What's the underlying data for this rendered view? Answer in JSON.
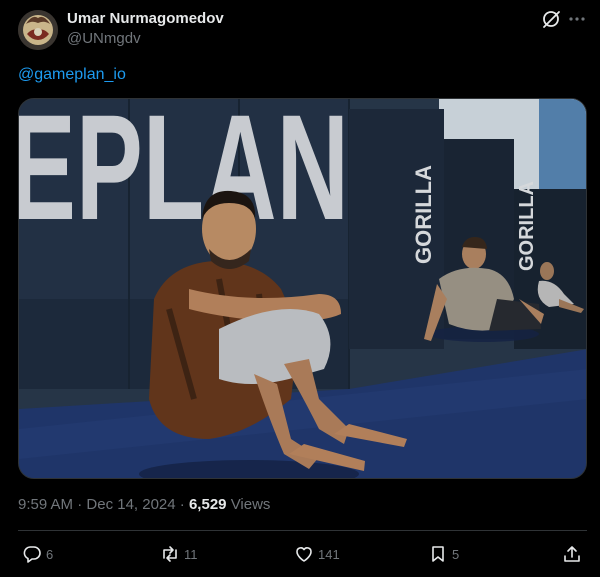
{
  "author": {
    "name": "Umar Nurmagomedov",
    "handle": "@UNmgdv"
  },
  "tweet": {
    "text": "@gameplan_io"
  },
  "media": {
    "wall_text_left": "EPLAN",
    "banner_text_1": "GORILLA",
    "banner_text_2": "GORILLA"
  },
  "meta": {
    "time": "9:59 AM",
    "separator": "·",
    "date": "Dec 14, 2024",
    "views_count": "6,529",
    "views_label": "Views"
  },
  "actions": {
    "replies": "6",
    "reposts": "11",
    "likes": "141",
    "bookmarks": "5"
  },
  "icons": {
    "grok": "grok-icon",
    "more": "more-icon",
    "reply": "reply-icon",
    "repost": "repost-icon",
    "like": "like-icon",
    "bookmark": "bookmark-icon",
    "share": "share-icon"
  },
  "colors": {
    "background": "#000000",
    "text": "#e7e9ea",
    "secondary": "#71767b",
    "link": "#1d9bf0",
    "divider": "#2f3336"
  }
}
